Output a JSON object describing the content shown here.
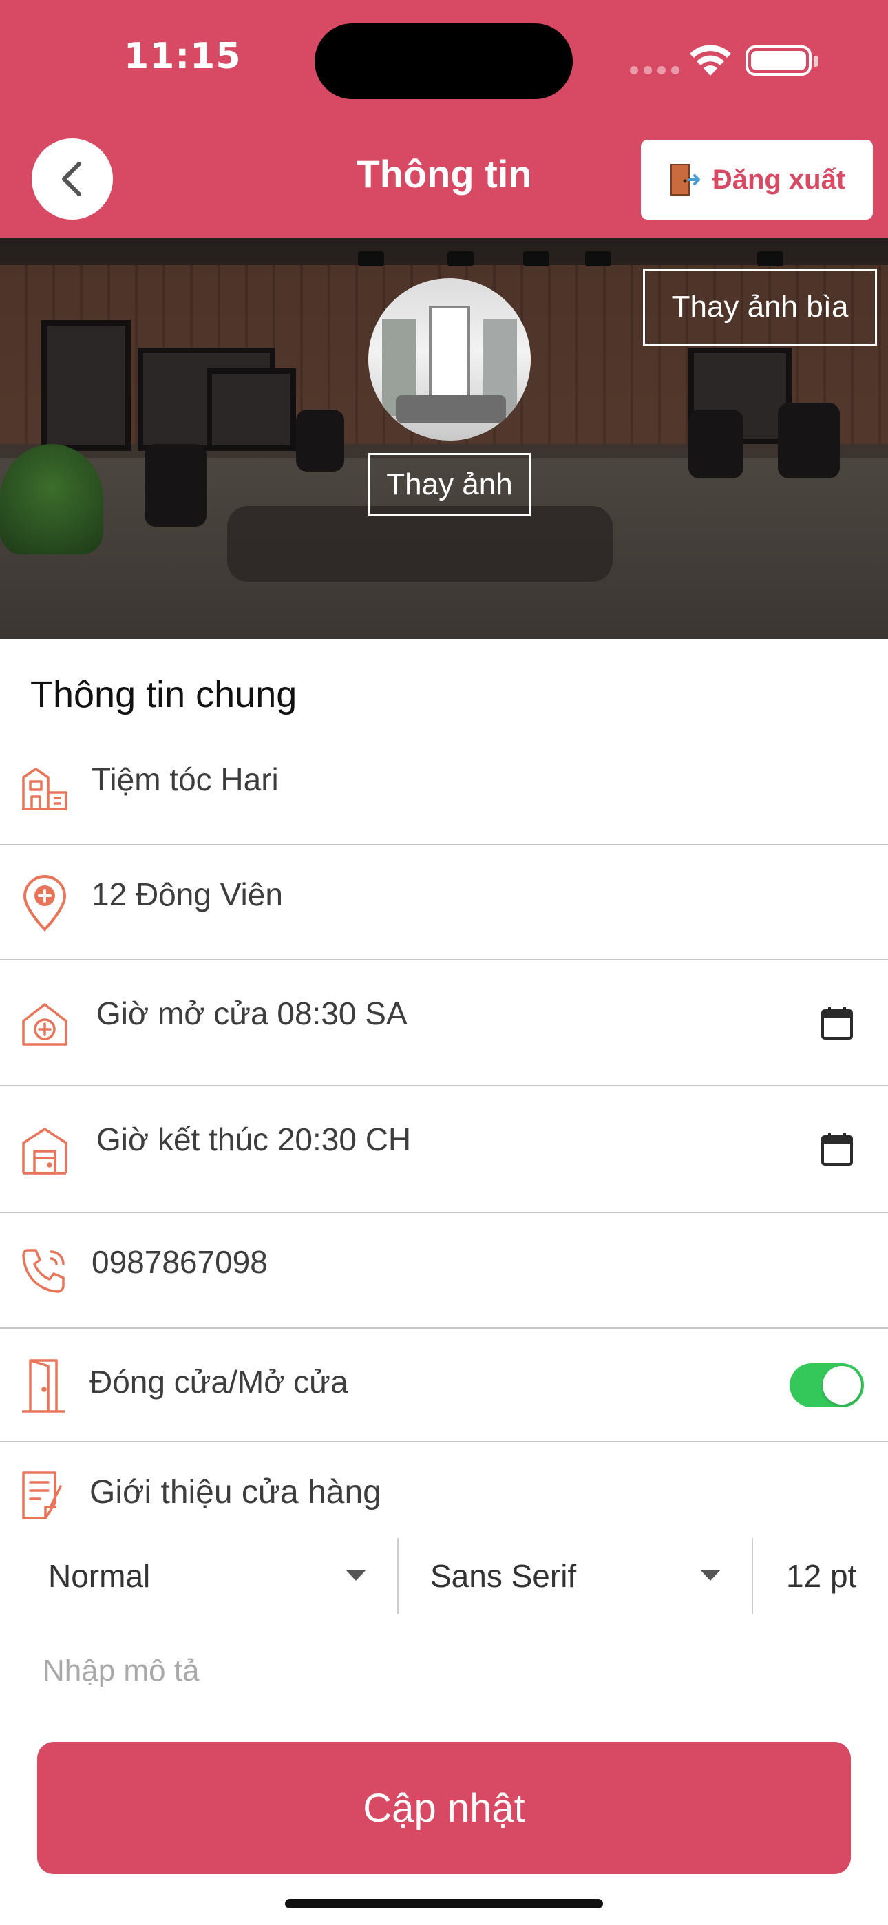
{
  "status_bar": {
    "time": "11:15"
  },
  "header": {
    "title": "Thông tin",
    "logout_label": "Đăng xuất"
  },
  "cover": {
    "change_cover_label": "Thay ảnh bìa",
    "change_avatar_label": "Thay ảnh"
  },
  "section": {
    "title": "Thông tin chung"
  },
  "fields": {
    "shop_name": "Tiệm tóc Hari",
    "address": "12 Đông Viên",
    "open_time": "Giờ mở cửa 08:30 SA",
    "close_time": "Giờ kết thúc 20:30 CH",
    "phone": "0987867098",
    "open_close_label": "Đóng cửa/Mở cửa",
    "open_close_on": true
  },
  "intro": {
    "label": "Giới thiệu cửa hàng",
    "toolbar": {
      "style": "Normal",
      "font": "Sans Serif",
      "size": "12 pt"
    },
    "placeholder": "Nhập mô tả"
  },
  "actions": {
    "update_label": "Cập nhật"
  },
  "colors": {
    "primary": "#d84a63",
    "icon": "#e8755a",
    "toggle_on": "#34c759"
  }
}
